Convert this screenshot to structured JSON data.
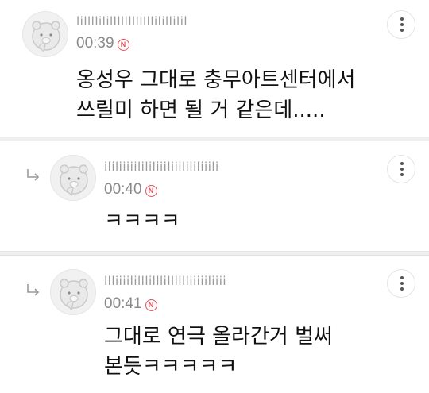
{
  "comments": [
    {
      "username": "lillllilillllllllllllilillilil",
      "time": "00:39",
      "new_badge": "N",
      "text": "옹성우 그대로 충무아트센터에서\n쓰릴미 하면 될 거 같은데.....",
      "is_reply": false
    },
    {
      "username": "ililiiiiilililiiiliiilililiiili",
      "time": "00:40",
      "new_badge": "N",
      "text": "ㅋㅋㅋㅋ",
      "is_reply": true
    },
    {
      "username": "llliiiililllilllilllllliiiiiliiii",
      "time": "00:41",
      "new_badge": "N",
      "text": "그대로 연극 올라간거 벌써\n본듯ㅋㅋㅋㅋㅋ",
      "is_reply": true
    }
  ],
  "icons": {
    "avatar": "bear-character-avatar",
    "more": "more-vertical-icon",
    "reply": "reply-arrow-icon",
    "new": "new-badge-icon"
  },
  "colors": {
    "badge": "#e8505b",
    "meta": "#8a8a8a",
    "divider": "#efefef"
  }
}
